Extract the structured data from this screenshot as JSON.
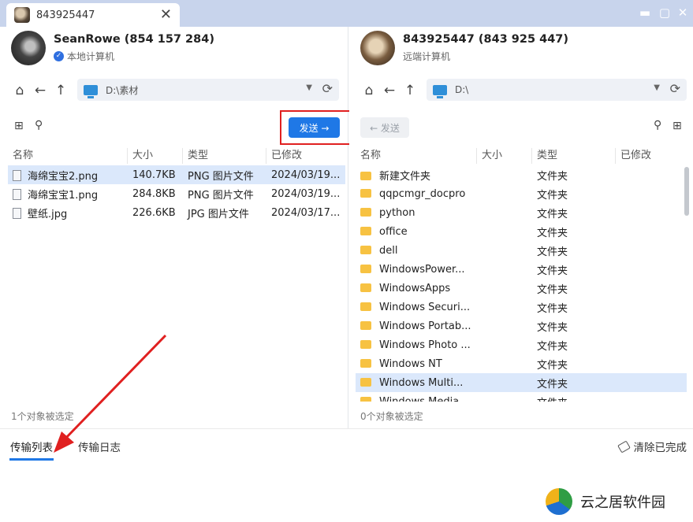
{
  "window": {
    "tab_title": "843925447",
    "close_symbol": "✕",
    "controls": [
      "▬",
      "▢",
      "✕"
    ]
  },
  "local": {
    "name": "SeanRowe (854 157 284)",
    "subtitle": "本地计算机",
    "path": "D:\\素材",
    "send_label": "发送 →",
    "columns": [
      "名称",
      "大小",
      "类型",
      "已修改"
    ],
    "files": [
      {
        "name": "海绵宝宝2.png",
        "size": "140.7KB",
        "type": "PNG 图片文件",
        "modified": "2024/03/19..."
      },
      {
        "name": "海绵宝宝1.png",
        "size": "284.8KB",
        "type": "PNG 图片文件",
        "modified": "2024/03/19..."
      },
      {
        "name": "壁纸.jpg",
        "size": "226.6KB",
        "type": "JPG 图片文件",
        "modified": "2024/03/17..."
      }
    ],
    "status": "1个对象被选定"
  },
  "remote": {
    "name": "843925447 (843 925 447)",
    "subtitle": "远端计算机",
    "path": "D:\\",
    "send_label": "← 发送",
    "columns": [
      "名称",
      "大小",
      "类型",
      "已修改"
    ],
    "folders": [
      {
        "name": "新建文件夹",
        "type": "文件夹"
      },
      {
        "name": "qqpcmgr_docpro",
        "type": "文件夹"
      },
      {
        "name": "python",
        "type": "文件夹"
      },
      {
        "name": "office",
        "type": "文件夹"
      },
      {
        "name": "dell",
        "type": "文件夹"
      },
      {
        "name": "WindowsPower...",
        "type": "文件夹"
      },
      {
        "name": "WindowsApps",
        "type": "文件夹"
      },
      {
        "name": "Windows Securi...",
        "type": "文件夹"
      },
      {
        "name": "Windows Portab...",
        "type": "文件夹"
      },
      {
        "name": "Windows Photo ...",
        "type": "文件夹"
      },
      {
        "name": "Windows NT",
        "type": "文件夹"
      },
      {
        "name": "Windows Multi...",
        "type": "文件夹"
      },
      {
        "name": "Windows Media",
        "type": "文件夹"
      }
    ],
    "status": "0个对象被选定"
  },
  "bottom": {
    "tabs": [
      "传输列表",
      "传输日志"
    ],
    "clear_label": "清除已完成"
  },
  "watermark": {
    "text": "云之居软件园"
  },
  "colors": {
    "accent": "#1f78e6",
    "highlight_box": "#e02020",
    "selection": "#dbe8fb"
  }
}
